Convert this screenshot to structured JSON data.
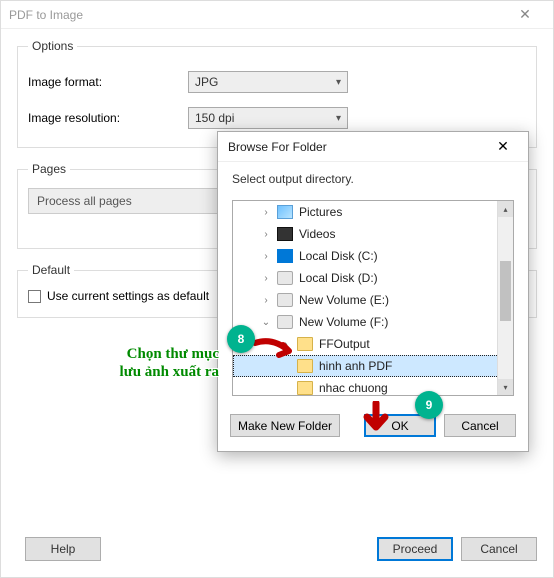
{
  "window": {
    "title": "PDF to Image",
    "close": "✕"
  },
  "options": {
    "legend": "Options",
    "format_label": "Image format:",
    "format_value": "JPG",
    "resolution_label": "Image resolution:",
    "resolution_value": "150 dpi"
  },
  "pages": {
    "legend": "Pages",
    "value": "Process all pages"
  },
  "default_group": {
    "legend": "Default",
    "checkbox_label": "Use current settings as default"
  },
  "buttons": {
    "help": "Help",
    "proceed": "Proceed",
    "cancel": "Cancel"
  },
  "dialog": {
    "title": "Browse For Folder",
    "close": "✕",
    "message": "Select output directory.",
    "make_new": "Make New Folder",
    "ok": "OK",
    "cancel": "Cancel",
    "tree": [
      {
        "exp": "›",
        "icon": "pic",
        "label": "Pictures",
        "sub": false
      },
      {
        "exp": "›",
        "icon": "vid",
        "label": "Videos",
        "sub": false
      },
      {
        "exp": "›",
        "icon": "win",
        "label": "Local Disk (C:)",
        "sub": false
      },
      {
        "exp": "›",
        "icon": "drive",
        "label": "Local Disk (D:)",
        "sub": false
      },
      {
        "exp": "›",
        "icon": "drive",
        "label": "New Volume (E:)",
        "sub": false
      },
      {
        "exp": "⌄",
        "icon": "drive",
        "label": "New Volume (F:)",
        "sub": false
      },
      {
        "exp": "›",
        "icon": "folder",
        "label": "FFOutput",
        "sub": true
      },
      {
        "exp": "",
        "icon": "folder",
        "label": "hinh anh PDF",
        "sub": true,
        "selected": true
      },
      {
        "exp": "",
        "icon": "folder",
        "label": "nhac chuong",
        "sub": true
      }
    ]
  },
  "annotations": {
    "badge8": "8",
    "badge9": "9",
    "text": "Chọn thư mục\nlưu ảnh xuất ra"
  }
}
